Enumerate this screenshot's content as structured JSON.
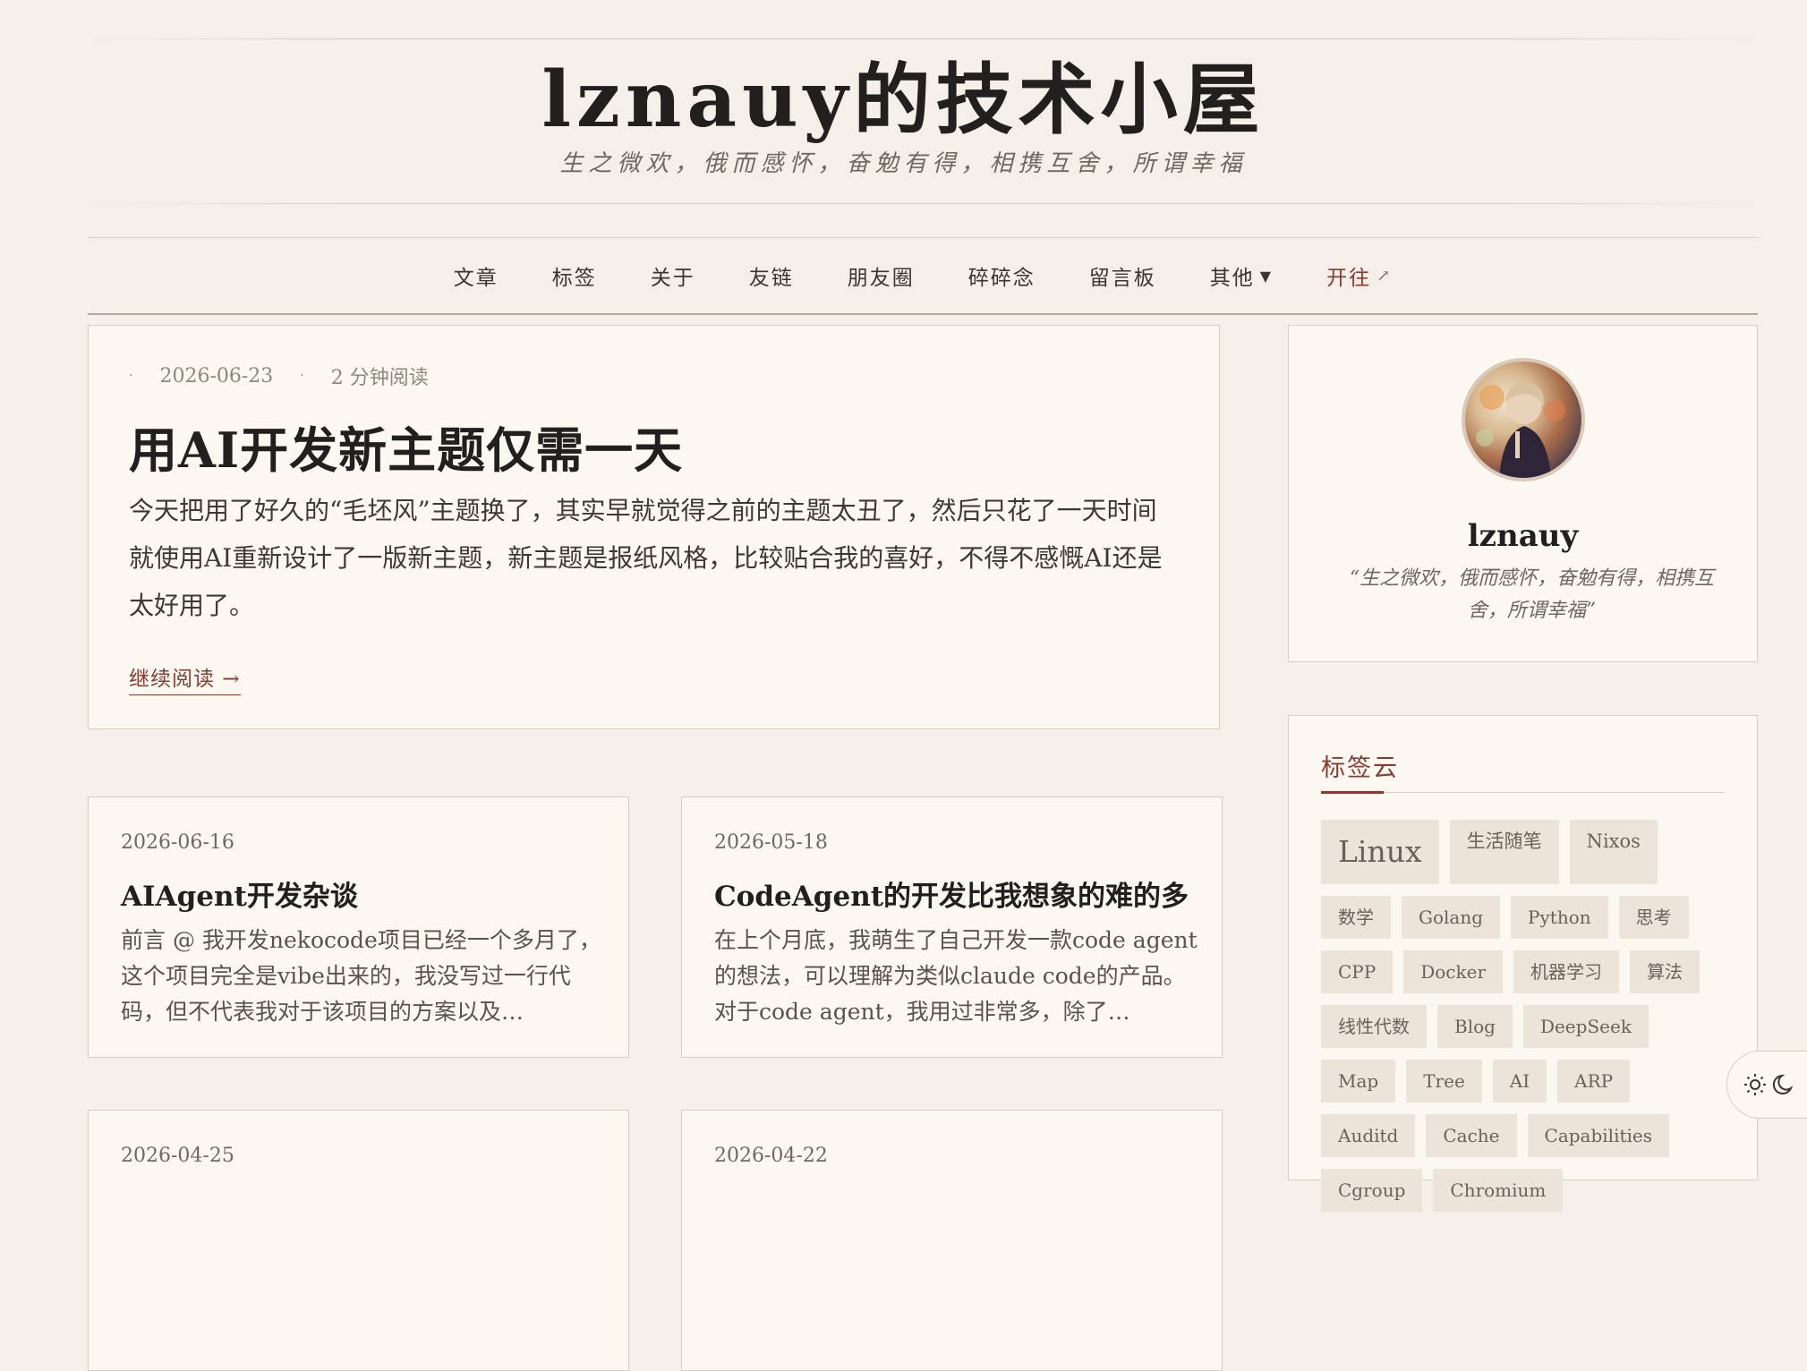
{
  "site": {
    "title": "lznauy的技术小屋",
    "subtitle": "生之微欢，俄而感怀，奋勉有得，相携互舍，所谓幸福"
  },
  "nav": {
    "items": [
      {
        "label": "文章"
      },
      {
        "label": "标签"
      },
      {
        "label": "关于"
      },
      {
        "label": "友链"
      },
      {
        "label": "朋友圈"
      },
      {
        "label": "碎碎念"
      },
      {
        "label": "留言板"
      },
      {
        "label": "其他",
        "dropdown_icon": "triangle-down-icon"
      },
      {
        "label": "开往",
        "external_icon": "external-arrow-icon"
      }
    ]
  },
  "featured": {
    "date": "2026-06-23",
    "reading_time": "2 分钟阅读",
    "title": "用AI开发新主题仅需一天",
    "excerpt": "今天把用了好久的“毛坯风”主题换了，其实早就觉得之前的主题太丑了，然后只花了一天时间就使用AI重新设计了一版新主题，新主题是报纸风格，比较贴合我的喜好，不得不感慨AI还是太好用了。",
    "read_more": "继续阅读 →"
  },
  "posts": [
    {
      "date": "2026-06-16",
      "title": "AIAgent开发杂谈",
      "excerpt": "前言 @ 我开发nekocode项目已经一个多月了，这个项目完全是vibe出来的，我没写过一行代码，但不代表我对于该项目的方案以及…"
    },
    {
      "date": "2026-05-18",
      "title": "CodeAgent的开发比我想象的难的多",
      "excerpt": "在上个月底，我萌生了自己开发一款code agent的想法，可以理解为类似claude code的产品。对于code agent，我用过非常多，除了…"
    },
    {
      "date": "2026-04-25",
      "title": "",
      "excerpt": ""
    },
    {
      "date": "2026-04-22",
      "title": "",
      "excerpt": ""
    }
  ],
  "profile": {
    "name": "lznauy",
    "quote": "“生之微欢，俄而感怀，奋勉有得，相携互舍，所谓幸福”"
  },
  "tagcloud": {
    "title": "标签云",
    "tags": [
      "Linux",
      "生活随笔",
      "Nixos",
      "数学",
      "Golang",
      "Python",
      "思考",
      "CPP",
      "Docker",
      "机器学习",
      "算法",
      "线性代数",
      "Blog",
      "DeepSeek",
      "Map",
      "Tree",
      "AI",
      "ARP",
      "Auditd",
      "Cache",
      "Capabilities",
      "Cgroup",
      "Chromium"
    ]
  },
  "theme_toggle": {
    "icons": [
      "sun-icon",
      "moon-icon"
    ]
  },
  "colors": {
    "background": "#f4f0e9",
    "card": "#fbf8f2",
    "accent": "#8a3a2e",
    "tag_bg": "#ece4d9"
  }
}
